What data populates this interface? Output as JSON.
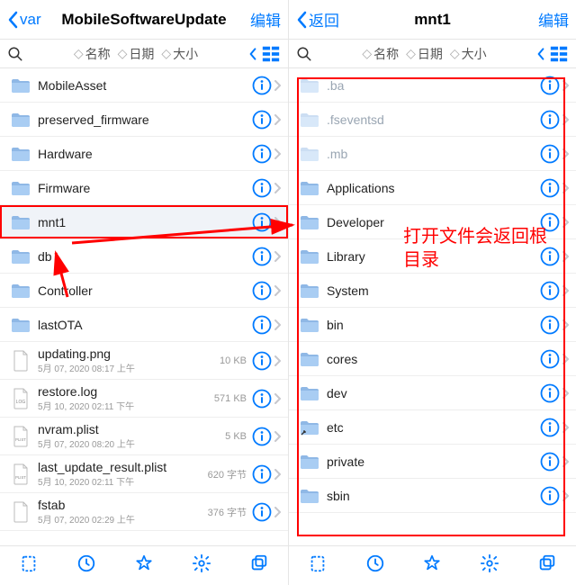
{
  "left": {
    "back_label": "var",
    "title": "MobileSoftwareUpdate",
    "edit_label": "编辑",
    "sort": {
      "name": "名称",
      "date": "日期",
      "size": "大小"
    },
    "items": [
      {
        "type": "folder",
        "name": "MobileAsset"
      },
      {
        "type": "folder",
        "name": "preserved_firmware"
      },
      {
        "type": "folder",
        "name": "Hardware"
      },
      {
        "type": "folder",
        "name": "Firmware"
      },
      {
        "type": "folder",
        "name": "mnt1",
        "highlight": true
      },
      {
        "type": "folder",
        "name": "db"
      },
      {
        "type": "folder",
        "name": "Controller"
      },
      {
        "type": "folder",
        "name": "lastOTA"
      },
      {
        "type": "file",
        "name": "updating.png",
        "sub": "5月 07, 2020 08:17 上午",
        "size": "10 KB",
        "kind": "generic"
      },
      {
        "type": "file",
        "name": "restore.log",
        "sub": "5月 10, 2020 02:11 下午",
        "size": "571 KB",
        "kind": "log"
      },
      {
        "type": "file",
        "name": "nvram.plist",
        "sub": "5月 07, 2020 08:20 上午",
        "size": "5 KB",
        "kind": "plist"
      },
      {
        "type": "file",
        "name": "last_update_result.plist",
        "sub": "5月 10, 2020 02:11 下午",
        "size": "620 字节",
        "kind": "plist"
      },
      {
        "type": "file",
        "name": "fstab",
        "sub": "5月 07, 2020 02:29 上午",
        "size": "376 字节",
        "kind": "generic"
      }
    ]
  },
  "right": {
    "back_label": "返回",
    "title": "mnt1",
    "edit_label": "编辑",
    "sort": {
      "name": "名称",
      "date": "日期",
      "size": "大小"
    },
    "items": [
      {
        "type": "folder",
        "name": ".ba",
        "dim": true
      },
      {
        "type": "folder",
        "name": ".fseventsd",
        "dim": true
      },
      {
        "type": "folder",
        "name": ".mb",
        "dim": true
      },
      {
        "type": "folder",
        "name": "Applications"
      },
      {
        "type": "folder",
        "name": "Developer"
      },
      {
        "type": "folder",
        "name": "Library"
      },
      {
        "type": "folder",
        "name": "System"
      },
      {
        "type": "folder",
        "name": "bin"
      },
      {
        "type": "folder",
        "name": "cores"
      },
      {
        "type": "folder",
        "name": "dev"
      },
      {
        "type": "folder",
        "name": "etc",
        "alias": true
      },
      {
        "type": "folder",
        "name": "private"
      },
      {
        "type": "folder",
        "name": "sbin"
      }
    ]
  },
  "annotations": {
    "note_text": "打开文件会返回根目录"
  }
}
